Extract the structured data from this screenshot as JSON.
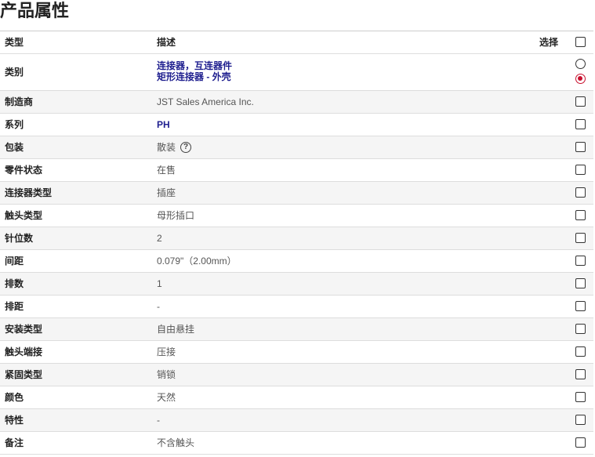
{
  "page_title": "产品属性",
  "table": {
    "header": {
      "type": "类型",
      "description": "描述",
      "select": "选择",
      "select_all_checked": false
    },
    "category": {
      "type": "类别",
      "links": [
        "连接器，互连器件",
        "矩形连接器 - 外壳"
      ],
      "selected_index": 1
    },
    "rows": [
      {
        "type": "制造商",
        "value": "JST Sales America Inc.",
        "selected": false
      },
      {
        "type": "系列",
        "value": "PH",
        "is_link": true,
        "selected": false
      },
      {
        "type": "包装",
        "value": "散装",
        "icon": "question-circle-icon",
        "selected": false
      },
      {
        "type": "零件状态",
        "value": "在售",
        "selected": false
      },
      {
        "type": "连接器类型",
        "value": "插座",
        "selected": false
      },
      {
        "type": "触头类型",
        "value": "母形插口",
        "selected": false
      },
      {
        "type": "针位数",
        "value": "2",
        "selected": false
      },
      {
        "type": "间距",
        "value": "0.079\"（2.00mm）",
        "selected": false
      },
      {
        "type": "排数",
        "value": "1",
        "selected": false
      },
      {
        "type": "排距",
        "value": "-",
        "selected": false
      },
      {
        "type": "安装类型",
        "value": "自由悬挂",
        "selected": false
      },
      {
        "type": "触头端接",
        "value": "压接",
        "selected": false
      },
      {
        "type": "紧固类型",
        "value": "销锁",
        "selected": false
      },
      {
        "type": "颜色",
        "value": "天然",
        "selected": false
      },
      {
        "type": "特性",
        "value": "-",
        "selected": false
      },
      {
        "type": "备注",
        "value": "不含触头",
        "selected": false
      }
    ]
  },
  "colors": {
    "link": "#1f1f8f",
    "radio_selected": "#c8102e",
    "row_alt_background": "#f5f5f5",
    "row_border": "#dddddd"
  }
}
